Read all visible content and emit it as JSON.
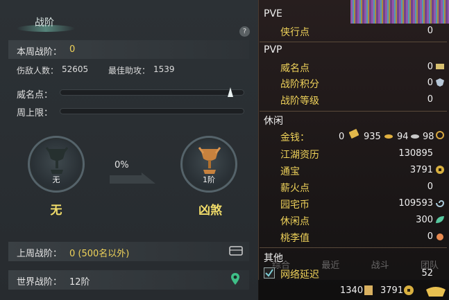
{
  "left": {
    "title": "战阶",
    "help": "?",
    "weekly_label": "本周战阶：",
    "weekly_value": "0",
    "kills_label": "伤敌人数：",
    "kills_value": "52605",
    "assist_label": "最佳助攻：",
    "assist_value": "1539",
    "prestige_label": "威名点：",
    "weekly_cap_label": "周上限：",
    "progress_pct": "0%",
    "current_rank_caption": "无",
    "current_rank_name": "无",
    "next_rank_caption": "1阶",
    "next_rank_name": "凶煞",
    "last_week_label": "上周战阶：",
    "last_week_value": "0 (500名以外)",
    "world_label": "世界战阶：",
    "world_value": "12阶"
  },
  "right": {
    "pve_title": "PVE",
    "pve_items": [
      {
        "label": "侠行点",
        "value": "0"
      }
    ],
    "pvp_title": "PVP",
    "pvp_items": [
      {
        "label": "威名点",
        "value": "0"
      },
      {
        "label": "战阶积分",
        "value": "0"
      },
      {
        "label": "战阶等级",
        "value": "0"
      }
    ],
    "leisure_title": "休闲",
    "money_label": "金钱：",
    "money_values": [
      "0",
      "935",
      "94",
      "98"
    ],
    "leisure_items": [
      {
        "label": "江湖资历",
        "value": "130895"
      },
      {
        "label": "通宝",
        "value": "3791"
      },
      {
        "label": "薪火点",
        "value": "0"
      },
      {
        "label": "园宅币",
        "value": "109593"
      },
      {
        "label": "休闲点",
        "value": "300"
      },
      {
        "label": "桃李值",
        "value": "0"
      }
    ],
    "other_title": "其他",
    "latency_label": "网络延迟",
    "latency_value": "52",
    "bottom_values": [
      "1340",
      "3791"
    ],
    "tabs": [
      "综合",
      "最近",
      "战斗",
      "团队"
    ]
  },
  "colors": {
    "gold": "#f1d45a",
    "panel_left": "#2c3135",
    "panel_right": "#1a1414"
  }
}
